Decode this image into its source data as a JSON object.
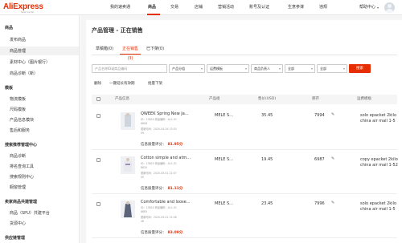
{
  "brand": {
    "name": "AliExpress",
    "sub": "Seller Center"
  },
  "nav": [
    "我的速卖通",
    "商品",
    "交易",
    "店铺",
    "营销活动",
    "账号及认证",
    "生意参谋",
    "违规"
  ],
  "help": "帮助中心",
  "sidebar": {
    "s1": "商品",
    "s1_items": [
      "发布商品",
      "商品管理",
      "素材中心（图片银行）",
      "商品诊断（新）"
    ],
    "s2": "模板",
    "s2_items": [
      "物流模板",
      "尺码模板",
      "产品信息模块",
      "售后和服务"
    ],
    "s3": "搜索推荐管理中心",
    "s3_items": [
      "商品诊断",
      "排名查询工具",
      "搜索规则中心",
      "橱窗管理"
    ],
    "s4": "卖家商品共建管理",
    "s4_items": [
      "商品（SPU）共建平台",
      "货源中心"
    ],
    "s5": "供应链管理"
  },
  "page": {
    "title": "产品管理 - 正在销售",
    "tabs": [
      "草稿箱(0)",
      "正在销售(3)",
      "已下架(0)"
    ]
  },
  "filters": {
    "search_placeholder": "产品名称ID或商品编码",
    "group": "产品分组",
    "template": "运费模板",
    "owner": "商品负责人",
    "all1": "全部",
    "all2": "全部",
    "search_button": "搜索"
  },
  "actions": [
    "删除",
    "一键延长有效期",
    "批量下架"
  ],
  "columns": [
    "产品信息",
    "产品组",
    "售价(USD)",
    "库存",
    "运费模板"
  ],
  "rows": [
    {
      "name": "QWEEK Spring New Ja...",
      "id": "ID：13820 商品编码：AL1-01",
      "code": "6808",
      "updated": "更新时间：2020-04-29 13:53",
      "updated2": "09",
      "score_label": "信息质量评分：",
      "score": "81.95分",
      "group": "MELE S...",
      "price": "35.45",
      "stock": "7994",
      "shipping": "solo epacket 2kilo china air mail 1-5"
    },
    {
      "name": "Cotton simple and atm...",
      "id": "ID：13820 商品编码：AL1-01",
      "code": "8820",
      "updated": "更新时间：2020-05-01 21:07",
      "updated2": "00",
      "score_label": "信息质量评分：",
      "score": "81.11分",
      "group": "MELE S...",
      "price": "19.45",
      "stock": "6987",
      "shipping": "copy epacket 2kilo china air mail 1-52"
    },
    {
      "name": "Comfortable and loose...",
      "id": "ID：13820 商品编码：AL1-01",
      "code": "8865",
      "updated": "更新时间：2020-05-01 21:06",
      "updated2": "46",
      "score_label": "信息质量评分：",
      "score": "83.09分",
      "group": "MELE S...",
      "price": "23.45",
      "stock": "7996",
      "shipping": "solo epacket 2kilo china air mail 1-5"
    }
  ],
  "colors": {
    "accent": "#e62e04"
  }
}
